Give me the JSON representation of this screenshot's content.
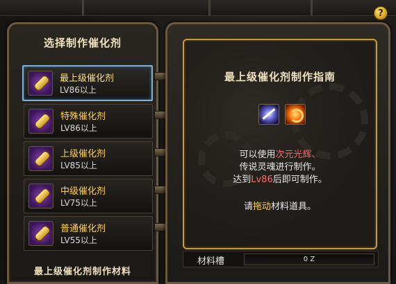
{
  "left_panel": {
    "title": "选择制作催化剂",
    "footer": "最上级催化剂制作材料",
    "items": [
      {
        "name": "最上级催化剂",
        "level": "LV86以上",
        "selected": true
      },
      {
        "name": "特殊催化剂",
        "level": "LV86以上",
        "selected": false
      },
      {
        "name": "上级催化剂",
        "level": "LV85以上",
        "selected": false
      },
      {
        "name": "中级催化剂",
        "level": "LV75以上",
        "selected": false
      },
      {
        "name": "普通催化剂",
        "level": "LV55以上",
        "selected": false
      }
    ]
  },
  "guide": {
    "title": "最上级催化剂制作指南",
    "line1_prefix": "可以使用",
    "line1_highlight": "次元光辉、",
    "line2": "传说灵魂进行制作。",
    "line3_prefix": "达到",
    "line3_highlight": "Lv86",
    "line3_suffix": "后即可制作。",
    "line4_prefix": "请",
    "line4_highlight": "拖动",
    "line4_suffix": "材料道具。",
    "materials": [
      "dimension-light-icon",
      "legend-soul-icon"
    ]
  },
  "slot": {
    "label": "材料槽",
    "value": "0 Z"
  },
  "help": {
    "symbol": "?"
  },
  "colors": {
    "accent_gold": "#ffd34a",
    "highlight_red": "#ff6a6a",
    "selected_border": "#7fb0d8",
    "frame": "#6b5a40"
  }
}
